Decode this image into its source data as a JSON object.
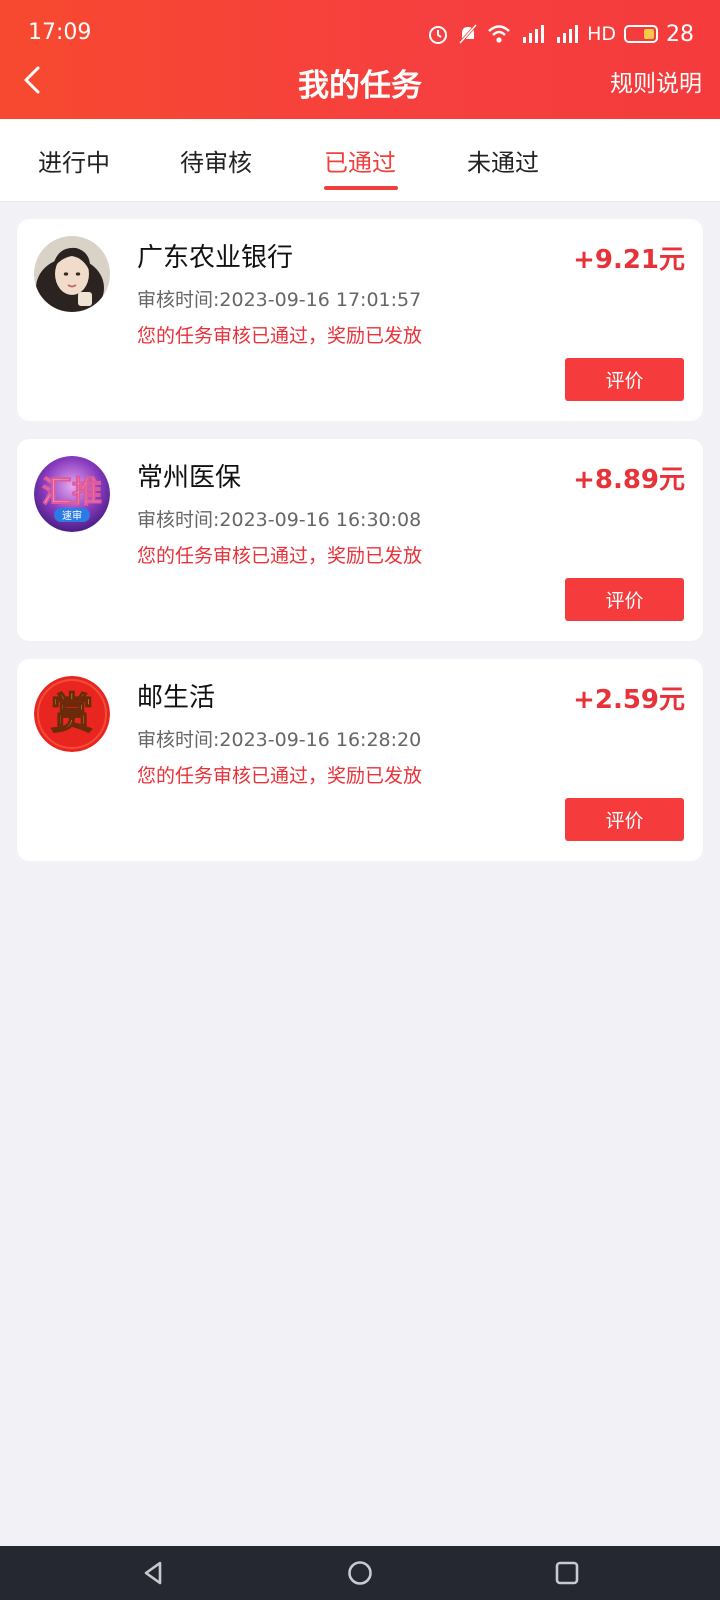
{
  "status_bar": {
    "time": "17:09",
    "network": "HD",
    "battery": "28",
    "icons": [
      "alarm-icon",
      "mute-icon",
      "wifi-icon",
      "signal-4g-icon",
      "signal-4g-icon",
      "battery-icon"
    ]
  },
  "header": {
    "title": "我的任务",
    "rules_label": "规则说明",
    "back_icon": "chevron-left-icon"
  },
  "tabs": [
    {
      "label": "进行中",
      "active": false
    },
    {
      "label": "待审核",
      "active": false
    },
    {
      "label": "已通过",
      "active": true
    },
    {
      "label": "未通过",
      "active": false
    }
  ],
  "tasks": [
    {
      "name": "广东农业银行",
      "reward": "+9.21元",
      "review_time": "审核时间:2023-09-16 17:01:57",
      "status": "您的任务审核已通过，奖励已发放",
      "button": "评价",
      "avatar": "portrait-avatar"
    },
    {
      "name": "常州医保",
      "reward": "+8.89元",
      "review_time": "审核时间:2023-09-16 16:30:08",
      "status": "您的任务审核已通过，奖励已发放",
      "button": "评价",
      "avatar": "huitui-logo",
      "avatar_text": "汇推",
      "avatar_subtext": "速审"
    },
    {
      "name": "邮生活",
      "reward": "+2.59元",
      "review_time": "审核时间:2023-09-16 16:28:20",
      "status": "您的任务审核已通过，奖励已发放",
      "button": "评价",
      "avatar": "shang-logo",
      "avatar_text": "赏"
    }
  ],
  "colors": {
    "header_bg": "#f6433a",
    "accent": "#f0403c",
    "reward": "#e8323a",
    "page_bg": "#f1f1f6"
  }
}
